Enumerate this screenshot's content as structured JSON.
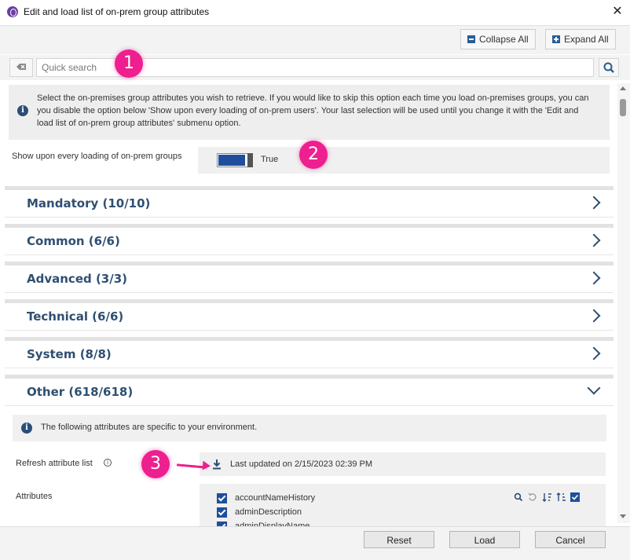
{
  "window": {
    "title": "Edit and load list of on-prem group attributes"
  },
  "toolbar": {
    "collapse_label": "Collapse All",
    "expand_label": "Expand All"
  },
  "search": {
    "placeholder": "Quick search"
  },
  "info": {
    "text": "Select the on-premises group attributes you wish to retrieve. If you would like to skip this option each time you load on-premises groups, you can you disable the option below 'Show upon every loading of on-prem users'. Your last selection will be used until you change it with the 'Edit and load list of on-prem group attributes' submenu option."
  },
  "show_option": {
    "label": "Show upon every loading of on-prem groups",
    "value": "True",
    "enabled": true
  },
  "sections": [
    {
      "label": "Mandatory (10/10)",
      "expanded": false
    },
    {
      "label": "Common (6/6)",
      "expanded": false
    },
    {
      "label": "Advanced (3/3)",
      "expanded": false
    },
    {
      "label": "Technical (6/6)",
      "expanded": false
    },
    {
      "label": "System (8/8)",
      "expanded": false
    },
    {
      "label": "Other (618/618)",
      "expanded": true
    }
  ],
  "other": {
    "info_text": "The following attributes are specific to your environment.",
    "refresh_label": "Refresh attribute list",
    "last_updated": "Last updated on 2/15/2023 02:39 PM",
    "attributes_label": "Attributes",
    "attributes": [
      "accountNameHistory",
      "adminDescription",
      "adminDisplayName"
    ]
  },
  "footer": {
    "reset_label": "Reset",
    "load_label": "Load",
    "cancel_label": "Cancel"
  },
  "callouts": [
    "1",
    "2",
    "3"
  ],
  "colors": {
    "accent": "#1f4f9c",
    "heading": "#2f4f72",
    "callout": "#ee1f8f"
  }
}
